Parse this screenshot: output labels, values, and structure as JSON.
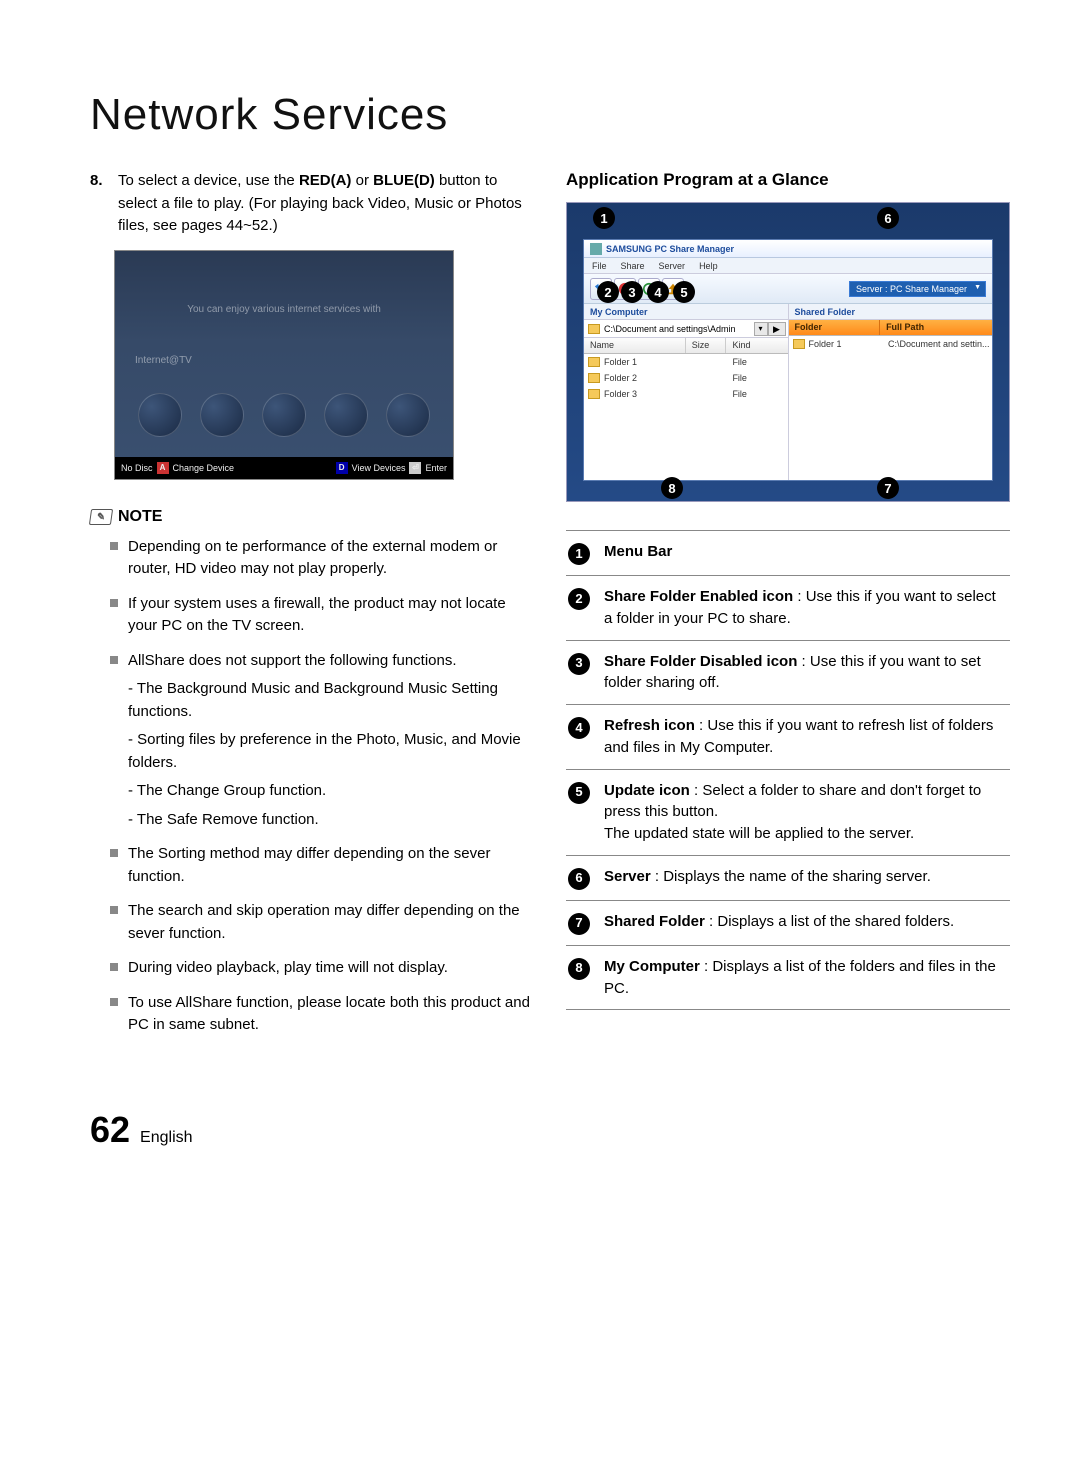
{
  "page_title": "Network Services",
  "step": {
    "num": "8.",
    "text_a": "To select a device, use the ",
    "red": "RED(A)",
    "text_b": " or ",
    "blue": "BLUE(D)",
    "text_c": " button to select a file to play. (For playing back Video, Music or Photos files, see pages 44~52.)"
  },
  "thumb": {
    "line1": "You can enjoy various internet services with",
    "line2": "Internet@TV",
    "bar_nodisc": "No Disc",
    "bar_change": "Change Device",
    "bar_view": "View Devices",
    "bar_enter": "Enter"
  },
  "note_label": "NOTE",
  "bullets": {
    "b1": "Depending on te performance of the external modem or router, HD video may not play properly.",
    "b2": "If your system uses a firewall, the product may not locate your PC on the TV screen.",
    "b3": "AllShare does not support the following functions.",
    "b3s1": "The Background Music and Background Music Setting functions.",
    "b3s2": "Sorting files by preference in the Photo, Music, and Movie folders.",
    "b3s3": "The Change Group function.",
    "b3s4": "The Safe Remove function.",
    "b4": "The Sorting method may differ depending on the sever function.",
    "b5": "The search and skip operation may differ depending on the sever function.",
    "b6": "During video playback, play time will not display.",
    "b7": "To use AllShare function, please locate both this product and PC in same subnet."
  },
  "app_head": "Application Program at a Glance",
  "win": {
    "title": "SAMSUNG PC Share Manager",
    "menu_file": "File",
    "menu_share": "Share",
    "menu_server": "Server",
    "menu_help": "Help",
    "server_label": "Server : PC Share Manager",
    "left_head": "My Computer",
    "right_head": "Shared Folder",
    "path": "C:\\Document and settings\\Admin",
    "col_name": "Name",
    "col_size": "Size",
    "col_kind": "Kind",
    "col_folder": "Folder",
    "col_full": "Full Path",
    "f1": "Folder 1",
    "f2": "Folder 2",
    "f3": "Folder 3",
    "kind_file": "File",
    "right_path": "C:\\Document and settin..."
  },
  "legend": {
    "l1": "Menu Bar",
    "l2b": "Share Folder Enabled icon",
    "l2": " : Use this if you want to select a folder in your PC to share.",
    "l3b": "Share Folder Disabled icon",
    "l3": " : Use this if you want to set folder sharing off.",
    "l4b": "Refresh icon",
    "l4": " : Use this if you want to refresh list of folders and files in My Computer.",
    "l5b": "Update icon",
    "l5": " : Select a folder to share and don't forget to press this button.\nThe updated state will be applied to the server.",
    "l6b": "Server",
    "l6": " : Displays the name of the sharing server.",
    "l7b": "Shared Folder",
    "l7": " : Displays a list of the shared folders.",
    "l8b": "My Computer",
    "l8": " : Displays a list of the folders and files in the PC."
  },
  "footer": {
    "page": "62",
    "lang": "English"
  }
}
